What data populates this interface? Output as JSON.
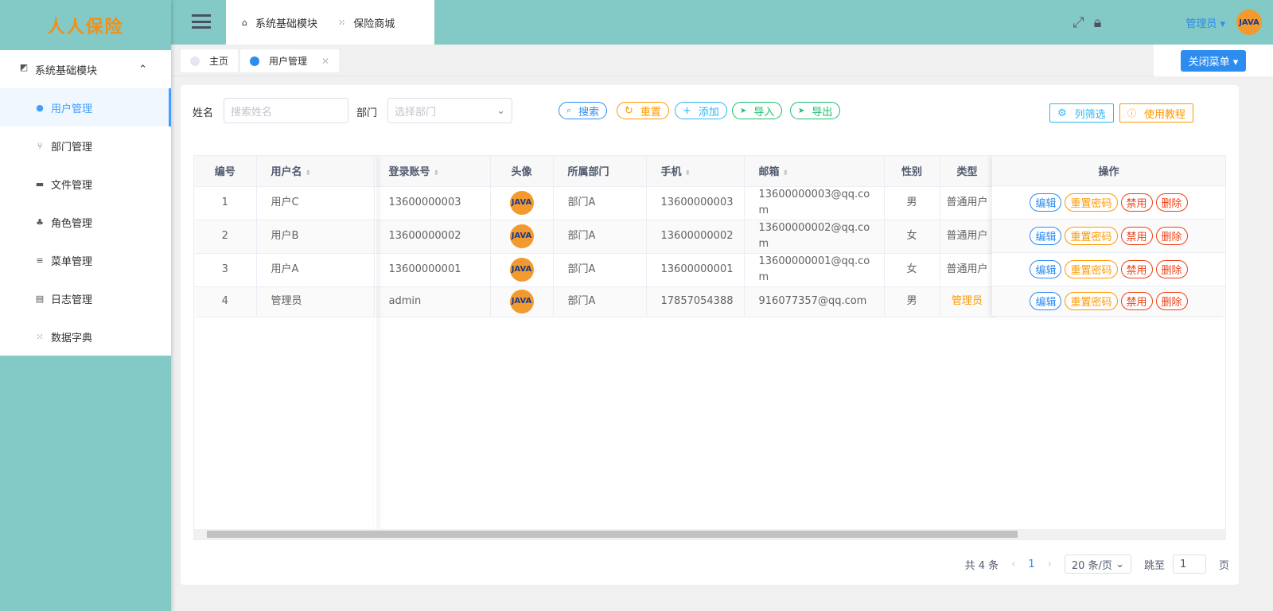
{
  "logo": {
    "text": "人人保险"
  },
  "sidebar": {
    "group": "系统基础模块",
    "items": [
      {
        "label": "用户管理",
        "icon": "user-icon"
      },
      {
        "label": "部门管理",
        "icon": "tree-icon"
      },
      {
        "label": "文件管理",
        "icon": "folder-icon"
      },
      {
        "label": "角色管理",
        "icon": "users-icon"
      },
      {
        "label": "菜单管理",
        "icon": "list-icon"
      },
      {
        "label": "日志管理",
        "icon": "log-icon"
      },
      {
        "label": "数据字典",
        "icon": "grid-icon"
      }
    ]
  },
  "header": {
    "nav": [
      "系统基础模块",
      "保险商城"
    ],
    "user": "管理员",
    "avatar": "JAVA"
  },
  "tags": {
    "home": "主页",
    "current": "用户管理",
    "close_menu": "关闭菜单"
  },
  "filters": {
    "name_label": "姓名",
    "name_placeholder": "搜索姓名",
    "dept_label": "部门",
    "dept_placeholder": "选择部门",
    "search": "搜索",
    "reset": "重置",
    "add": "添加",
    "import": "导入",
    "export": "导出",
    "columns": "列筛选",
    "tutorial": "使用教程"
  },
  "table": {
    "headers": [
      "编号",
      "用户名",
      "登录账号",
      "头像",
      "所属部门",
      "手机",
      "邮箱",
      "性别",
      "类型",
      "操作"
    ],
    "rows": [
      {
        "id": "1",
        "name": "用户C",
        "account": "13600000003",
        "dept": "部门A",
        "phone": "13600000003",
        "email1": "13600000003@qq.co",
        "email2": "m",
        "sex": "男",
        "type": "普通用户"
      },
      {
        "id": "2",
        "name": "用户B",
        "account": "13600000002",
        "dept": "部门A",
        "phone": "13600000002",
        "email1": "13600000002@qq.co",
        "email2": "m",
        "sex": "女",
        "type": "普通用户"
      },
      {
        "id": "3",
        "name": "用户A",
        "account": "13600000001",
        "dept": "部门A",
        "phone": "13600000001",
        "email1": "13600000001@qq.co",
        "email2": "m",
        "sex": "女",
        "type": "普通用户"
      },
      {
        "id": "4",
        "name": "管理员",
        "account": "admin",
        "dept": "部门A",
        "phone": "17857054388",
        "email1": "916077357@qq.com",
        "email2": "",
        "sex": "男",
        "type": "管理员"
      }
    ],
    "actions": {
      "edit": "编辑",
      "reset_pwd": "重置密码",
      "disable": "禁用",
      "delete": "删除"
    }
  },
  "pager": {
    "total": "共 4 条",
    "page": "1",
    "size": "20 条/页",
    "jump": "跳至",
    "jump_value": "1",
    "page_suffix": "页"
  }
}
